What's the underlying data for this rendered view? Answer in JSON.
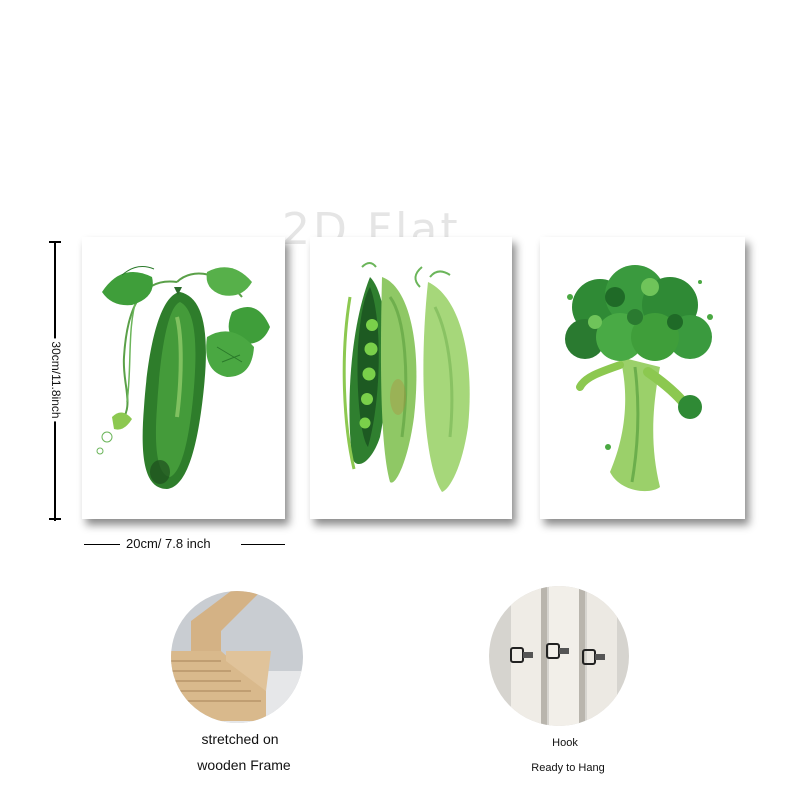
{
  "watermark": "2D Flat",
  "dimensions": {
    "height_label": "30cm/11.8inch",
    "width_label": "20cm/ 7.8 inch"
  },
  "panels": [
    {
      "subject": "cucumber-painting"
    },
    {
      "subject": "peapods-painting"
    },
    {
      "subject": "broccoli-painting"
    }
  ],
  "features": {
    "frame": {
      "line1": "stretched on",
      "line2": "wooden Frame"
    },
    "hook": {
      "line1": "Hook",
      "line2": "Ready to Hang"
    }
  },
  "colors": {
    "leaf_green": "#3f9e3a",
    "dark_green": "#1f5a1f",
    "light_green": "#9ccf6a",
    "wood": "#d9b98c"
  }
}
